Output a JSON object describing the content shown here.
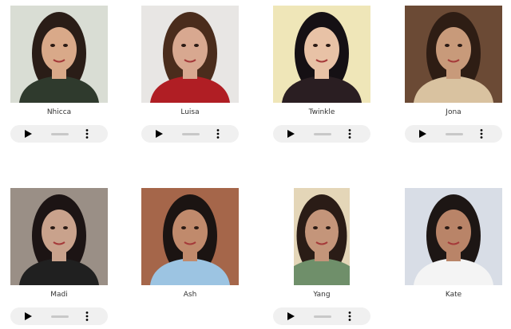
{
  "people": [
    {
      "name": "Nhicca",
      "has_player": true,
      "bg": "#d9ddd4",
      "skin": "#d9a989",
      "hair": "#2a1d17",
      "shirt": "#2f3a2d"
    },
    {
      "name": "Luisa",
      "has_player": true,
      "bg": "#e8e6e4",
      "skin": "#d8a890",
      "hair": "#4a2c1c",
      "shirt": "#b01e24"
    },
    {
      "name": "Twinkle",
      "has_player": true,
      "bg": "#efe6b8",
      "skin": "#e8c2a6",
      "hair": "#151014",
      "shirt": "#2a1e22"
    },
    {
      "name": "Jona",
      "has_player": true,
      "bg": "#6b4a35",
      "skin": "#c89a7a",
      "hair": "#2e1d14",
      "shirt": "#d9c2a0"
    },
    {
      "name": "Madi",
      "has_player": true,
      "bg": "#9a8f86",
      "skin": "#c9a28c",
      "hair": "#1c1414",
      "shirt": "#202020"
    },
    {
      "name": "Ash",
      "has_player": false,
      "bg": "#a5664a",
      "skin": "#c08a6c",
      "hair": "#1b1412",
      "shirt": "#9cc4e2"
    },
    {
      "name": "Yang",
      "has_player": true,
      "bg": "#e4d6b8",
      "skin": "#c4957a",
      "hair": "#2a1c16",
      "shirt": "#6f8f6a"
    },
    {
      "name": "Kate",
      "has_player": false,
      "bg": "#d8dde6",
      "skin": "#b98468",
      "hair": "#1d1614",
      "shirt": "#f4f4f4"
    }
  ]
}
